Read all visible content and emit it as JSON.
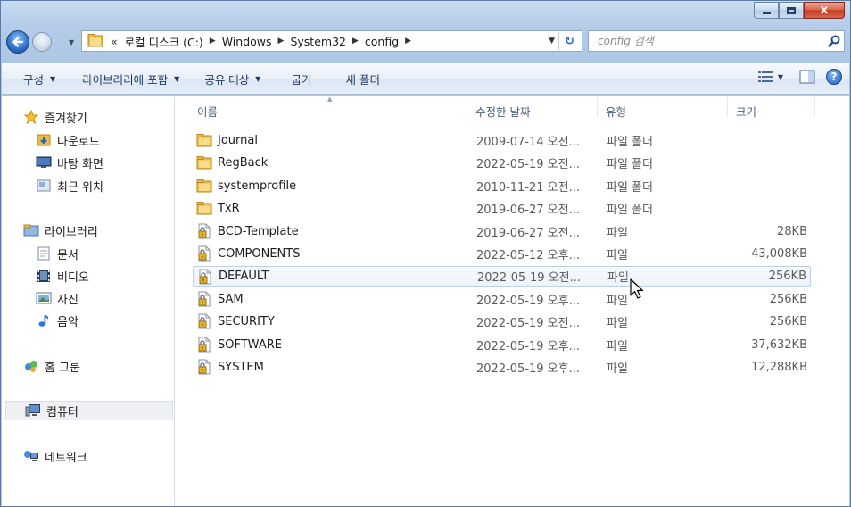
{
  "window": {
    "controls": {
      "minimize": "minimize",
      "maximize": "maximize",
      "close": "x"
    }
  },
  "address": {
    "overflow": "«",
    "crumbs": [
      "로컬 디스크 (C:)",
      "Windows",
      "System32",
      "config"
    ],
    "refresh": "↻"
  },
  "search": {
    "placeholder": "config 검색"
  },
  "toolbar": {
    "organize": "구성",
    "include_library": "라이브러리에 포함",
    "share_with": "공유 대상",
    "burn": "굽기",
    "new_folder": "새 폴더",
    "help": "?"
  },
  "nav": {
    "favorites": "즐겨찾기",
    "downloads": "다운로드",
    "desktop": "바탕 화면",
    "recent": "최근 위치",
    "libraries": "라이브러리",
    "documents": "문서",
    "videos": "비디오",
    "pictures": "사진",
    "music": "음악",
    "homegroup": "홈 그룹",
    "computer": "컴퓨터",
    "network": "네트워크"
  },
  "columns": {
    "name": "이름",
    "date": "수정한 날짜",
    "type": "유형",
    "size": "크기"
  },
  "files": [
    {
      "name": "Journal",
      "date": "2009-07-14 오전...",
      "type": "파일 폴더",
      "size": "",
      "kind": "folder"
    },
    {
      "name": "RegBack",
      "date": "2022-05-19 오전...",
      "type": "파일 폴더",
      "size": "",
      "kind": "folder"
    },
    {
      "name": "systemprofile",
      "date": "2010-11-21 오전...",
      "type": "파일 폴더",
      "size": "",
      "kind": "folder"
    },
    {
      "name": "TxR",
      "date": "2019-06-27 오전...",
      "type": "파일 폴더",
      "size": "",
      "kind": "folder"
    },
    {
      "name": "BCD-Template",
      "date": "2019-06-27 오전...",
      "type": "파일",
      "size": "28KB",
      "kind": "file"
    },
    {
      "name": "COMPONENTS",
      "date": "2022-05-12 오후...",
      "type": "파일",
      "size": "43,008KB",
      "kind": "file"
    },
    {
      "name": "DEFAULT",
      "date": "2022-05-19 오전...",
      "type": "파일",
      "size": "256KB",
      "kind": "file"
    },
    {
      "name": "SAM",
      "date": "2022-05-19 오후...",
      "type": "파일",
      "size": "256KB",
      "kind": "file"
    },
    {
      "name": "SECURITY",
      "date": "2022-05-19 오전...",
      "type": "파일",
      "size": "256KB",
      "kind": "file"
    },
    {
      "name": "SOFTWARE",
      "date": "2022-05-19 오후...",
      "type": "파일",
      "size": "37,632KB",
      "kind": "file"
    },
    {
      "name": "SYSTEM",
      "date": "2022-05-19 오후...",
      "type": "파일",
      "size": "12,288KB",
      "kind": "file"
    }
  ],
  "hovered_file": "DEFAULT"
}
